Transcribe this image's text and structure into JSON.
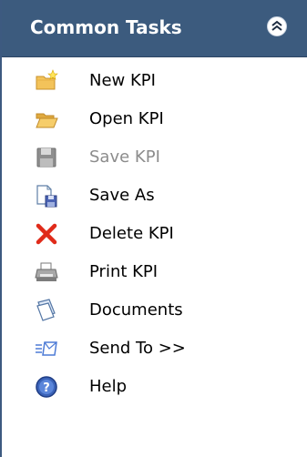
{
  "panel": {
    "title": "Common Tasks",
    "collapse_icon": "double-chevron-up-icon"
  },
  "items": [
    {
      "label": "New KPI",
      "icon": "new-folder-star-icon",
      "enabled": true
    },
    {
      "label": "Open KPI",
      "icon": "open-folder-icon",
      "enabled": true
    },
    {
      "label": "Save KPI",
      "icon": "floppy-disk-icon",
      "enabled": false
    },
    {
      "label": "Save As",
      "icon": "document-save-as-icon",
      "enabled": true
    },
    {
      "label": "Delete KPI",
      "icon": "red-x-delete-icon",
      "enabled": true
    },
    {
      "label": "Print KPI",
      "icon": "printer-icon",
      "enabled": true
    },
    {
      "label": "Documents",
      "icon": "documents-icon",
      "enabled": true
    },
    {
      "label": "Send To >>",
      "icon": "send-to-icon",
      "enabled": true
    },
    {
      "label": "Help",
      "icon": "help-question-icon",
      "enabled": true
    }
  ],
  "colors": {
    "header_background": "#3c5b7e",
    "header_text": "#ffffff",
    "disabled_text": "#8c8c8c",
    "delete_red": "#e02b1a",
    "folder_yellow": "#f3c35a"
  }
}
